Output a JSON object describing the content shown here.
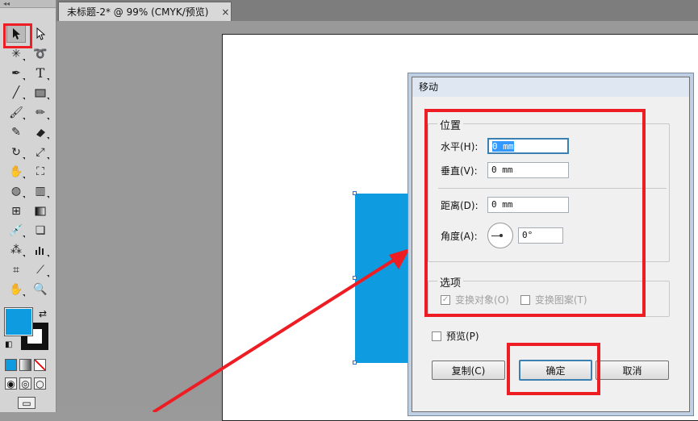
{
  "toolbox": {
    "grip_label": "◂◂",
    "tools": [
      [
        "selection-tool",
        "direct-selection-tool"
      ],
      [
        "magic-wand-tool",
        "lasso-tool"
      ],
      [
        "pen-tool",
        "type-tool"
      ],
      [
        "line-segment-tool",
        "rectangle-tool"
      ],
      [
        "paintbrush-tool",
        "pencil-tool"
      ],
      [
        "blob-brush-tool",
        "eraser-tool"
      ],
      [
        "rotate-tool",
        "scale-tool"
      ],
      [
        "warp-tool",
        "free-transform-tool"
      ],
      [
        "shape-builder-tool",
        "perspective-grid-tool"
      ],
      [
        "mesh-tool",
        "gradient-tool"
      ],
      [
        "eyedropper-tool",
        "blend-tool"
      ],
      [
        "symbol-sprayer-tool",
        "column-graph-tool"
      ],
      [
        "artboard-tool",
        "slice-tool"
      ],
      [
        "hand-tool",
        "zoom-tool"
      ]
    ],
    "fill_color": "#0e9be0",
    "stroke_color": "#111111"
  },
  "document_tab": {
    "title": "未标题-2* @ 99% (CMYK/预览)",
    "close": "×"
  },
  "canvas": {
    "rect_color": "#0e9be0"
  },
  "move_dialog": {
    "title": "移动",
    "position_group": {
      "label": "位置",
      "horizontal_label": "水平(H):",
      "horizontal_value": "0 mm",
      "vertical_label": "垂直(V):",
      "vertical_value": "0 mm",
      "distance_label": "距离(D):",
      "distance_value": "0 mm",
      "angle_label": "角度(A):",
      "angle_value": "0°"
    },
    "options_group": {
      "label": "选项",
      "transform_objects": "变换对象(O)",
      "transform_patterns": "变换图案(T)"
    },
    "preview_label": "预览(P)",
    "copy_button": "复制(C)",
    "ok_button": "确定",
    "cancel_button": "取消"
  },
  "annotation_color": "#ee1d24"
}
